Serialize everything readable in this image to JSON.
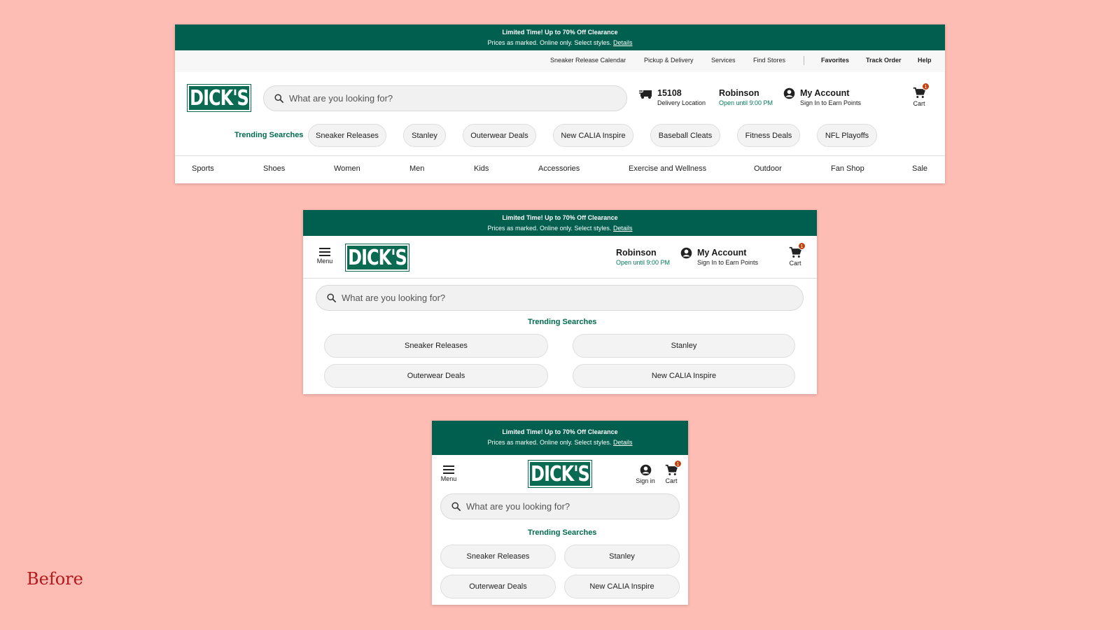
{
  "promo": {
    "line1": "Limited Time! Up to 70% Off Clearance",
    "line2": "Prices as marked. Online only. Select styles.",
    "details": "Details"
  },
  "brand": {
    "logo_text": "DICK'S"
  },
  "utility_links": [
    "Sneaker Release Calendar",
    "Pickup & Delivery",
    "Services",
    "Find Stores",
    "Favorites",
    "Track Order",
    "Help"
  ],
  "search": {
    "placeholder": "What are you looking for?"
  },
  "delivery": {
    "zip": "15108",
    "label": "Delivery Location"
  },
  "store": {
    "name": "Robinson",
    "hours": "Open until 9:00 PM"
  },
  "account": {
    "title": "My Account",
    "subtitle": "Sign In to Earn Points",
    "signin": "Sign in"
  },
  "cart": {
    "label": "Cart",
    "count": "1"
  },
  "menu": {
    "label": "Menu"
  },
  "trending": {
    "label": "Trending Searches",
    "items": [
      "Sneaker Releases",
      "Stanley",
      "Outerwear Deals",
      "New CALIA Inspire",
      "Baseball Cleats",
      "Fitness Deals",
      "NFL Playoffs"
    ]
  },
  "nav": [
    "Sports",
    "Shoes",
    "Women",
    "Men",
    "Kids",
    "Accessories",
    "Exercise and Wellness",
    "Outdoor",
    "Fan Shop",
    "Sale"
  ],
  "caption": "Before",
  "colors": {
    "brand_green": "#005f4e",
    "accent_green": "#006a4e",
    "badge": "#c2410c",
    "background": "#fdbcb4",
    "caption": "#b3191c"
  }
}
